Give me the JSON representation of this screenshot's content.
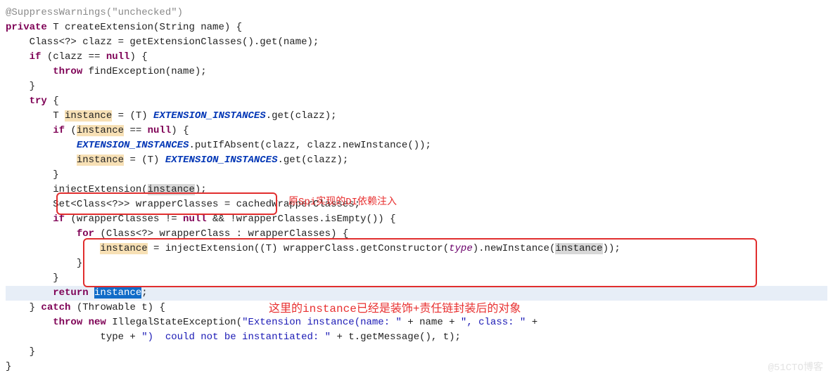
{
  "domain": "Document",
  "language": "java",
  "code": {
    "annotation": "@SuppressWarnings(\"unchecked\")",
    "line_decl_private": "private",
    "line_decl_rest": " T createExtension(String name) {",
    "line_clazz": "    Class<?> clazz = getExtensionClasses().get(name);",
    "line_if_kw": "    if",
    "line_if_cond": " (clazz == ",
    "null_kw": "null",
    "line_if_end": ") {",
    "line_throw_kw": "        throw",
    "line_throw_rest": " findException(name);",
    "brace_if_close": "    }",
    "line_try_kw": "    try",
    "line_try_brace": " {",
    "line_T": "        T ",
    "instance": "instance",
    "line_assign1": " = (T) ",
    "ext_inst": "EXTENSION_INSTANCES",
    "line_assign2": ".get(clazz);",
    "line_if2_kw": "        if",
    "line_if2_cond_a": " (",
    "line_if2_cond_b": " == ",
    "line_if2_cond_c": ") {",
    "line_put": "            ",
    "line_put_rest": ".putIfAbsent(clazz, clazz.newInstance());",
    "line_assign3a": "            ",
    "line_assign3b": " = (T) ",
    "line_assign3c": ".get(clazz);",
    "brace_if2_close": "        }",
    "line_inject_a": "        injectExtension(",
    "line_inject_b": ");",
    "line_set": "        Set<Class<?>> wrapperClasses = cachedWrapperClasses;",
    "line_if3_kw": "        if",
    "line_if3_a": " (wrapperClasses != ",
    "line_if3_b": " && !wrapperClasses.isEmpty()) {",
    "line_for_kw": "            for",
    "line_for_a": " (Class<?> wrapperClass : wrapperClasses) {",
    "line_for_body_a": "                ",
    "line_for_body_b": " = injectExtension((T) wrapperClass.getConstructor(type).newInstance(",
    "line_for_body_c": "));",
    "brace_for_close": "            }",
    "brace_if3_close": "        }",
    "line_return_kw": "        return",
    "line_return_sp": " ",
    "line_return_semi": ";",
    "line_catch_a": "    } ",
    "catch_kw": "catch",
    "line_catch_b": " (Throwable t) {",
    "line_throw2a": "        throw new",
    "line_throw2b": " IllegalStateException(",
    "str1": "\"Extension instance(name: \"",
    "plus": " + name + ",
    "str2": "\", class: \"",
    "plus2": " +",
    "line_throw3a": "                type + ",
    "str3": "\")  could not be instantiated: \"",
    "line_throw3b": " + t.getMessage(), t);",
    "brace_catch_close": "    }",
    "brace_method_close": "}",
    "var_type": "type"
  },
  "annotations": {
    "comment1": "原Spi实现的DI依赖注入",
    "comment2": "这里的instance已经是装饰+责任链封装后的对象"
  },
  "watermark": "@51CTO博客"
}
